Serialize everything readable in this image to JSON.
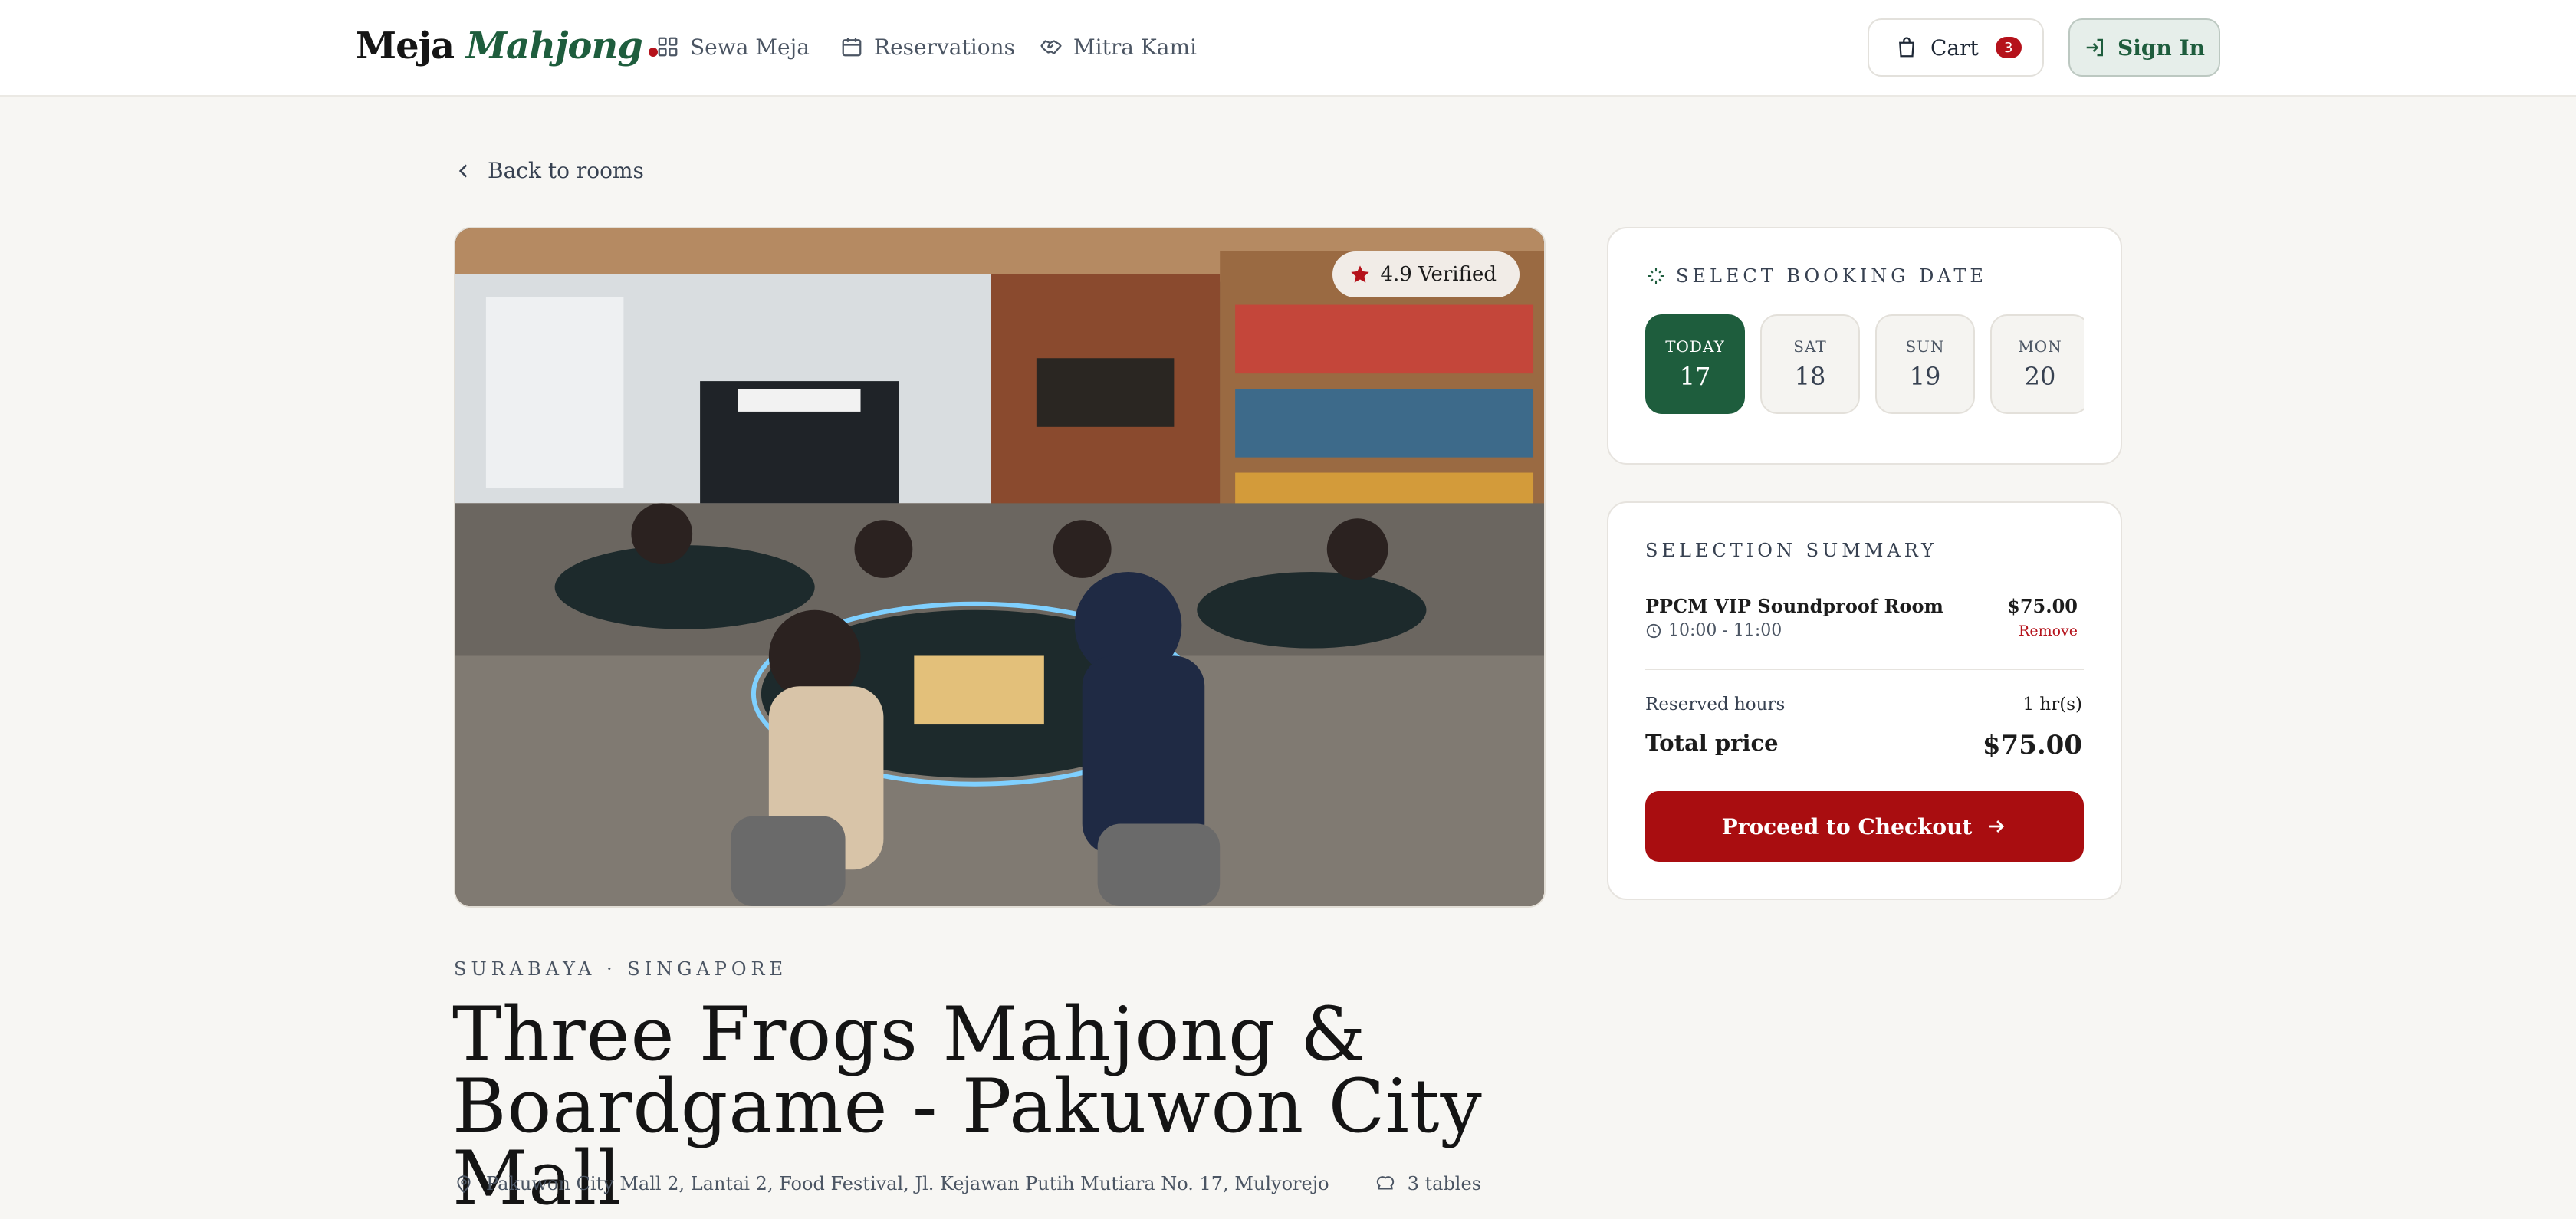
{
  "brand": {
    "name_part1": "Meja",
    "name_part2": "Mahjong"
  },
  "nav": [
    {
      "label": "Sewa Meja",
      "icon": "grid-icon"
    },
    {
      "label": "Reservations",
      "icon": "calendar-icon"
    },
    {
      "label": "Mitra Kami",
      "icon": "handshake-icon"
    }
  ],
  "cart": {
    "label": "Cart",
    "count": "3"
  },
  "signin": {
    "label": "Sign In"
  },
  "back_link": "Back to rooms",
  "hero": {
    "rating": "4.9 Verified",
    "alt_icon": "star-icon"
  },
  "venue": {
    "location": "SURABAYA · SINGAPORE",
    "title": "Three Frogs Mahjong & Boardgame - Pakuwon City Mall",
    "address": "Pakuwon City Mall 2, Lantai 2, Food Festival, Jl. Kejawan Putih Mutiara No. 17, Mulyorejo",
    "tables": "3 tables"
  },
  "booking": {
    "heading": "SELECT BOOKING DATE",
    "dates": [
      {
        "dow": "TODAY",
        "dom": "17",
        "active": true
      },
      {
        "dow": "SAT",
        "dom": "18",
        "active": false
      },
      {
        "dow": "SUN",
        "dom": "19",
        "active": false
      },
      {
        "dow": "MON",
        "dom": "20",
        "active": false
      }
    ]
  },
  "summary": {
    "heading": "SELECTION SUMMARY",
    "item_name": "PPCM VIP Soundproof Room",
    "item_time": "10:00 - 11:00",
    "item_price": "$75.00",
    "remove_label": "Remove",
    "hours_label": "Reserved hours",
    "hours_value": "1 hr(s)",
    "total_label": "Total price",
    "total_value": "$75.00",
    "checkout_label": "Proceed to Checkout"
  },
  "colors": {
    "brand_green": "#1e5d3d",
    "accent_red": "#b5121b",
    "checkout_red": "#a90d10",
    "background": "#f7f6f3"
  }
}
